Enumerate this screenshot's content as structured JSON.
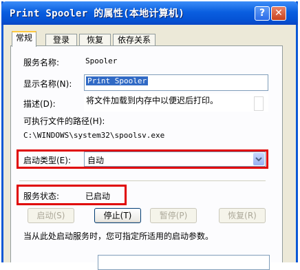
{
  "window": {
    "title": "Print Spooler 的属性(本地计算机)"
  },
  "titlebar": {
    "help_glyph": "?",
    "close_glyph": "✕"
  },
  "tabs": [
    {
      "label": "常规",
      "active": true
    },
    {
      "label": "登录",
      "active": false
    },
    {
      "label": "恢复",
      "active": false
    },
    {
      "label": "依存关系",
      "active": false
    }
  ],
  "general": {
    "service_name_label": "服务名称:",
    "service_name_value": "Spooler",
    "display_name_label": "显示名称(N):",
    "display_name_value": "Print Spooler",
    "description_label": "描述(D):",
    "description_value": "将文件加载到内存中以便迟后打印。",
    "exe_path_label": "可执行文件的路径(H):",
    "exe_path_value": "C:\\WINDOWS\\system32\\spoolsv.exe",
    "startup_type_label": "启动类型(E):",
    "startup_type_value": "自动",
    "service_status_label": "服务状态:",
    "service_status_value": "已启动"
  },
  "buttons": {
    "start": "启动(S)",
    "stop": "停止(T)",
    "pause": "暂停(P)",
    "resume": "恢复(R)"
  },
  "hint": "当从此处启动服务时，您可指定所适用的启动参数。",
  "colors": {
    "highlight": "#E00000",
    "titlebar": "#0A5FE0",
    "selection": "#316AC5"
  }
}
